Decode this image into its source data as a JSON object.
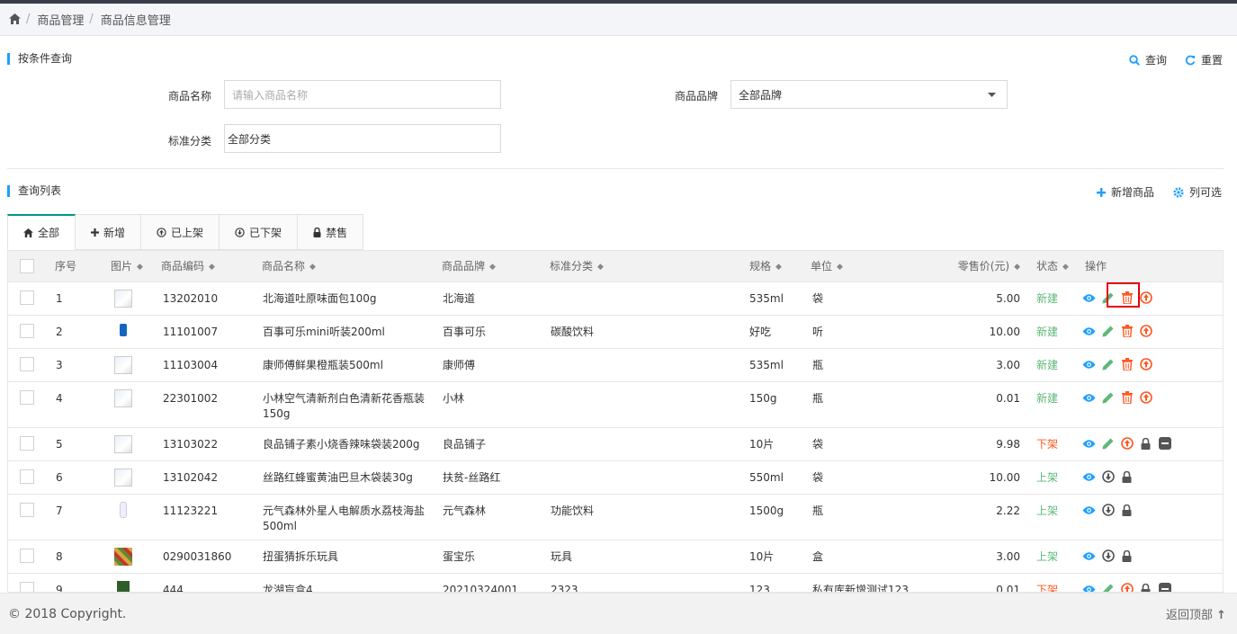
{
  "breadcrumb": {
    "home_icon": "home-icon",
    "items": [
      "商品管理",
      "商品信息管理"
    ]
  },
  "filter": {
    "title": "按条件查询",
    "query_label": "查询",
    "reset_label": "重置",
    "name_label": "商品名称",
    "name_placeholder": "请输入商品名称",
    "brand_label": "商品品牌",
    "brand_value": "全部品牌",
    "category_label": "标准分类",
    "category_value": "全部分类"
  },
  "list": {
    "title": "查询列表",
    "add_label": "新增商品",
    "columns_label": "列可选",
    "tabs": [
      {
        "label": "全部",
        "icon": "home-icon"
      },
      {
        "label": "新增",
        "icon": "plus-icon"
      },
      {
        "label": "已上架",
        "icon": "arrow-up-circle-icon"
      },
      {
        "label": "已下架",
        "icon": "arrow-down-circle-icon"
      },
      {
        "label": "禁售",
        "icon": "lock-icon"
      }
    ],
    "headers": [
      "序号",
      "图片",
      "商品编码",
      "商品名称",
      "商品品牌",
      "标准分类",
      "规格",
      "单位",
      "零售价(元)",
      "状态",
      "操作"
    ],
    "rows": [
      {
        "no": "1",
        "code": "13202010",
        "name": "北海道吐原味面包100g",
        "brand": "北海道",
        "category": "",
        "spec": "535ml",
        "unit": "袋",
        "price": "5.00",
        "status": "新建"
      },
      {
        "no": "2",
        "code": "11101007",
        "name": "百事可乐mini听装200ml",
        "brand": "百事可乐",
        "category": "碳酸饮料",
        "spec": "好吃",
        "unit": "听",
        "price": "10.00",
        "status": "新建"
      },
      {
        "no": "3",
        "code": "11103004",
        "name": "康师傅鲜果橙瓶装500ml",
        "brand": "康师傅",
        "category": "",
        "spec": "535ml",
        "unit": "瓶",
        "price": "3.00",
        "status": "新建"
      },
      {
        "no": "4",
        "code": "22301002",
        "name": "小林空气清新剂白色清新花香瓶装150g",
        "brand": "小林",
        "category": "",
        "spec": "150g",
        "unit": "瓶",
        "price": "0.01",
        "status": "新建"
      },
      {
        "no": "5",
        "code": "13103022",
        "name": "良品铺子素小烧香辣味袋装200g",
        "brand": "良品铺子",
        "category": "",
        "spec": "10片",
        "unit": "袋",
        "price": "9.98",
        "status": "下架"
      },
      {
        "no": "6",
        "code": "13102042",
        "name": "丝路红蜂蜜黄油巴旦木袋装30g",
        "brand": "扶贫-丝路红",
        "category": "",
        "spec": "550ml",
        "unit": "袋",
        "price": "10.00",
        "status": "上架"
      },
      {
        "no": "7",
        "code": "11123221",
        "name": "元气森林外星人电解质水荔枝海盐500ml",
        "brand": "元气森林",
        "category": "功能饮料",
        "spec": "1500g",
        "unit": "瓶",
        "price": "2.22",
        "status": "上架"
      },
      {
        "no": "8",
        "code": "0290031860",
        "name": "扭蛋猜拆乐玩具",
        "brand": "蛋宝乐",
        "category": "玩具",
        "spec": "10片",
        "unit": "盒",
        "price": "3.00",
        "status": "上架"
      },
      {
        "no": "9",
        "code": "444",
        "name": "龙湖盲盒4",
        "brand": "20210324001",
        "category": "2323",
        "spec": "123",
        "unit": "私有库新增测试123",
        "price": "0.01",
        "status": "下架"
      }
    ]
  },
  "footer": {
    "copyright": "© 2018 Copyright.",
    "back_to_top": "返回顶部"
  },
  "colors": {
    "accent": "#1e9fff",
    "green": "#5fb878",
    "orange": "#ff5722",
    "teal": "#009688",
    "view": "#1e9fff"
  }
}
